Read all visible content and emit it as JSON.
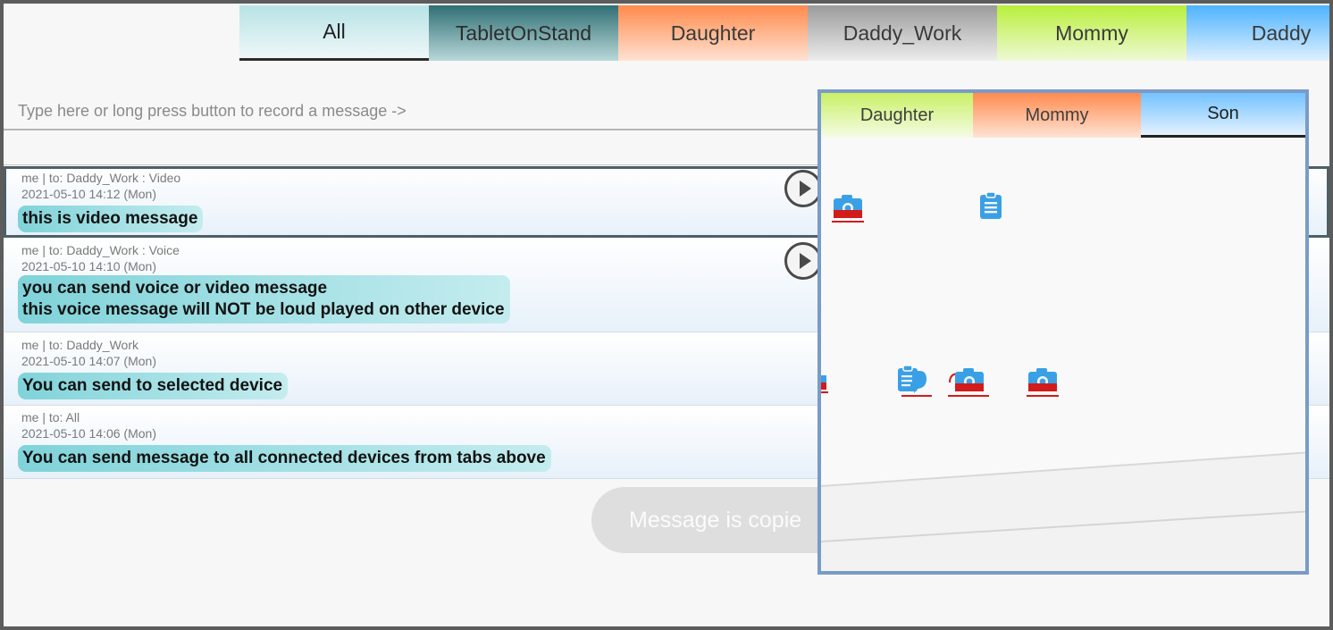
{
  "tabs": [
    {
      "label": "All",
      "key": "all"
    },
    {
      "label": "TabletOnStand",
      "key": "tablet"
    },
    {
      "label": "Daughter",
      "key": "daughter"
    },
    {
      "label": "Daddy_Work",
      "key": "daddywork"
    },
    {
      "label": "Mommy",
      "key": "mommy"
    },
    {
      "label": "Daddy",
      "key": "daddy"
    }
  ],
  "input": {
    "placeholder": "Type here or long press button to record a message ->"
  },
  "messages": [
    {
      "meta": "me | to: Daddy_Work : Video",
      "time": "2021-05-10 14:12 (Mon)",
      "lines": [
        "this is video message"
      ],
      "has_play": true
    },
    {
      "meta": "me | to: Daddy_Work : Voice",
      "time": "2021-05-10 14:10 (Mon)",
      "lines": [
        "you can send voice or video message",
        "this voice message will NOT be loud played on other device"
      ],
      "has_play": true
    },
    {
      "meta": "me | to: Daddy_Work",
      "time": "2021-05-10 14:07 (Mon)",
      "lines": [
        "You can send to selected device"
      ],
      "has_play": false
    },
    {
      "meta": "me | to: All",
      "time": "2021-05-10 14:06 (Mon)",
      "lines": [
        "You can send message to all connected devices from tabs above"
      ],
      "has_play": false
    }
  ],
  "toast": {
    "text": "Message is copie"
  },
  "overlay": {
    "tabs": [
      {
        "label": "Daughter",
        "key": "daughter"
      },
      {
        "label": "Mommy",
        "key": "mommy"
      },
      {
        "label": "Son",
        "key": "son"
      }
    ]
  },
  "colors": {
    "accent": "#2b2b2b",
    "bubble": "#7fd3d9",
    "overlay_border": "#7a9bc8",
    "camera_icon": "#3aa0e6",
    "record_red": "#d21b1b"
  },
  "icons": [
    "play-icon",
    "camera-icon",
    "clipboard-icon"
  ]
}
